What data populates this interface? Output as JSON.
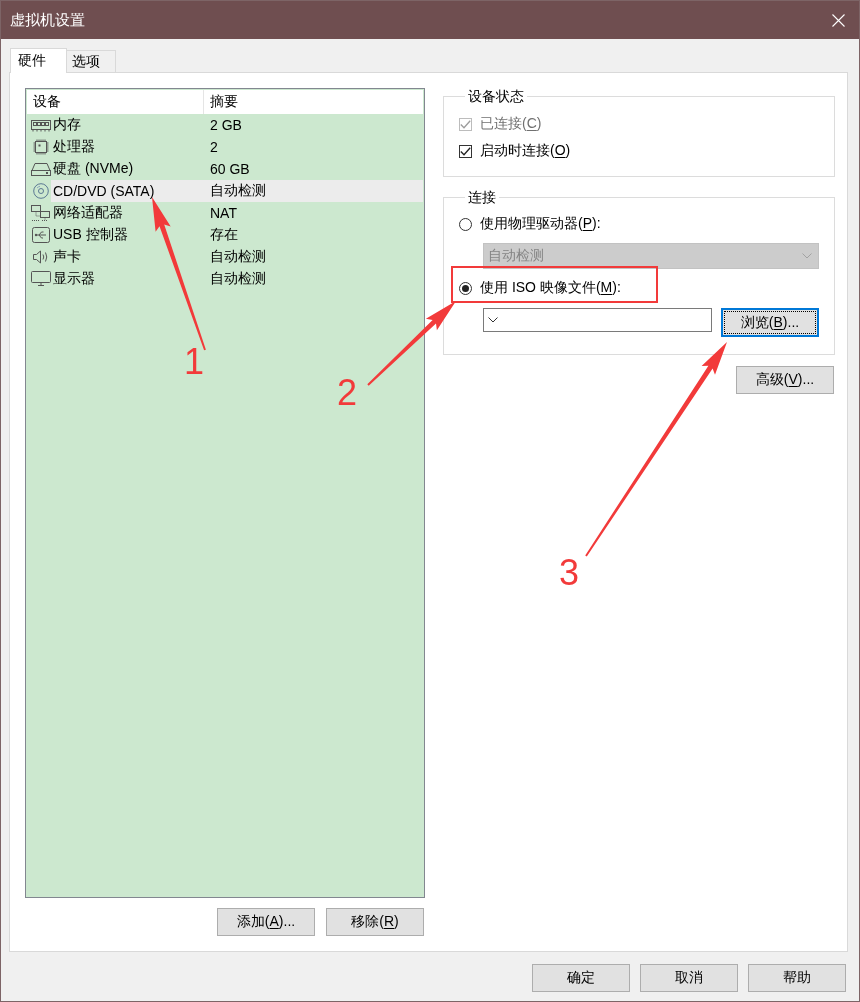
{
  "window": {
    "title": "虚拟机设置"
  },
  "tabs": [
    {
      "label": "硬件",
      "selected": true
    },
    {
      "label": "选项",
      "selected": false
    }
  ],
  "hardware": {
    "device_list": {
      "columns": [
        "设备",
        "摘要"
      ],
      "rows": [
        {
          "kind": "memory",
          "device": "内存",
          "summary": "2 GB",
          "selected": false
        },
        {
          "kind": "processor",
          "device": "处理器",
          "summary": "2",
          "selected": false
        },
        {
          "kind": "disk",
          "device": "硬盘 (NVMe)",
          "summary": "60 GB",
          "selected": false
        },
        {
          "kind": "cd",
          "device": "CD/DVD (SATA)",
          "summary": "自动检测",
          "selected": true
        },
        {
          "kind": "network",
          "device": "网络适配器",
          "summary": "NAT",
          "selected": false
        },
        {
          "kind": "usb",
          "device": "USB 控制器",
          "summary": "存在",
          "selected": false
        },
        {
          "kind": "sound",
          "device": "声卡",
          "summary": "自动检测",
          "selected": false
        },
        {
          "kind": "display",
          "device": "显示器",
          "summary": "自动检测",
          "selected": false
        }
      ]
    },
    "list_buttons": [
      {
        "label": "添加(",
        "access_key": "A",
        "label_end": ")..."
      },
      {
        "label": "移除(",
        "access_key": "R",
        "label_end": ")"
      }
    ],
    "device_status": {
      "title": "设备状态",
      "checkboxes": [
        {
          "label": "已连接(",
          "access_key": "C",
          "label_end": ")",
          "checked": true,
          "disabled": true
        },
        {
          "label": "启动时连接(",
          "access_key": "O",
          "label_end": ")",
          "checked": true,
          "disabled": false
        }
      ]
    },
    "connection": {
      "title": "连接",
      "options": [
        {
          "label": "使用物理驱动器(",
          "access_key": "P",
          "label_end": "):",
          "selected": false,
          "field": {
            "value": "自动检测",
            "disabled": true
          }
        },
        {
          "label": "使用 ISO 映像文件(",
          "access_key": "M",
          "label_end": "):",
          "selected": true,
          "highlighted": true,
          "field": {
            "disabled": false
          },
          "browse_button": {
            "label": "浏览(",
            "access_key": "B",
            "label_end": ")...",
            "focused": true
          }
        }
      ]
    },
    "advanced_button": {
      "label": "高级(",
      "access_key": "V",
      "label_end": ")..."
    }
  },
  "dialog_buttons": [
    {
      "label": "确定"
    },
    {
      "label": "取消"
    },
    {
      "label": "帮助"
    }
  ],
  "annotations": [
    {
      "label": "1"
    },
    {
      "label": "2"
    },
    {
      "label": "3"
    }
  ]
}
